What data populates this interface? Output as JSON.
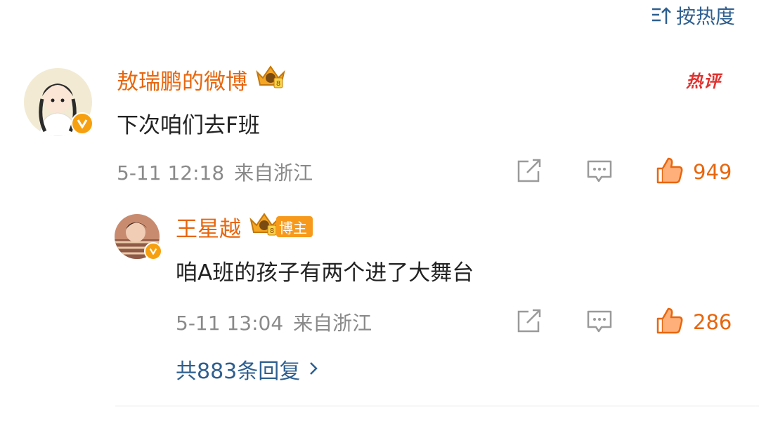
{
  "sort": {
    "label": "按热度",
    "icon": "sort-icon"
  },
  "comment": {
    "username": "敖瑞鹏的微博",
    "text": "下次咱们去F班",
    "date": "5-11 12:18",
    "location": "来自浙江",
    "hot_label": "热评",
    "likes": "949",
    "icons": [
      "share-icon",
      "comment-icon",
      "like-icon",
      "crown-badge-icon",
      "verified-v-icon"
    ]
  },
  "reply": {
    "username": "王星越",
    "badge": "博主",
    "text": "咱A班的孩子有两个进了大舞台",
    "date": "5-11 13:04",
    "location": "来自浙江",
    "likes": "286"
  },
  "replies_link": {
    "label": "共883条回复"
  },
  "colors": {
    "accent": "#e8660d",
    "link": "#2e5f8f",
    "meta": "#8a8a8a",
    "hot": "#e0322f"
  }
}
